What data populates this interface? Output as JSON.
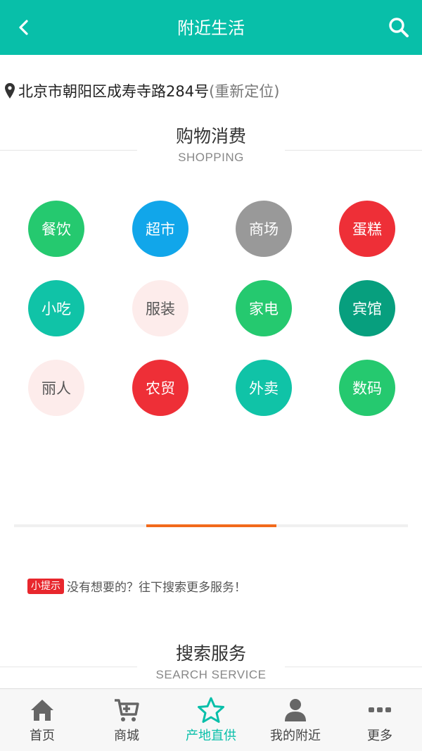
{
  "header": {
    "title": "附近生活",
    "back_icon": "chevron-left-icon",
    "search_icon": "search-icon",
    "bg_color": "#08bfa9"
  },
  "location": {
    "address": "北京市朝阳区成寿寺路284号",
    "relocate_label": "(重新定位)"
  },
  "shopping": {
    "title_zh": "购物消费",
    "title_en": "SHOPPING",
    "categories": [
      {
        "label": "餐饮",
        "color": "#25c96f"
      },
      {
        "label": "超市",
        "color": "#11a6ea"
      },
      {
        "label": "商场",
        "color": "#999999"
      },
      {
        "label": "蛋糕",
        "color": "#ee2f37"
      },
      {
        "label": "小吃",
        "color": "#10c3a7"
      },
      {
        "label": "服装",
        "color": "#fdeceb"
      },
      {
        "label": "家电",
        "color": "#25c96f"
      },
      {
        "label": "宾馆",
        "color": "#079f7e"
      },
      {
        "label": "丽人",
        "color": "#fdeceb"
      },
      {
        "label": "农贸",
        "color": "#ee2f37"
      },
      {
        "label": "外卖",
        "color": "#10c3a7"
      },
      {
        "label": "数码",
        "color": "#25c96f"
      }
    ]
  },
  "tip": {
    "badge": "小提示",
    "text": "没有想要的？往下搜索更多服务！"
  },
  "search_service": {
    "title_zh": "搜索服务",
    "title_en": "SEARCH SERVICE"
  },
  "tabbar": {
    "active_color": "#08bfa9",
    "items": [
      {
        "label": "首页",
        "icon": "home-icon"
      },
      {
        "label": "商城",
        "icon": "cart-icon"
      },
      {
        "label": "产地直供",
        "icon": "star-icon"
      },
      {
        "label": "我的附近",
        "icon": "user-icon"
      },
      {
        "label": "更多",
        "icon": "more-icon"
      }
    ]
  }
}
